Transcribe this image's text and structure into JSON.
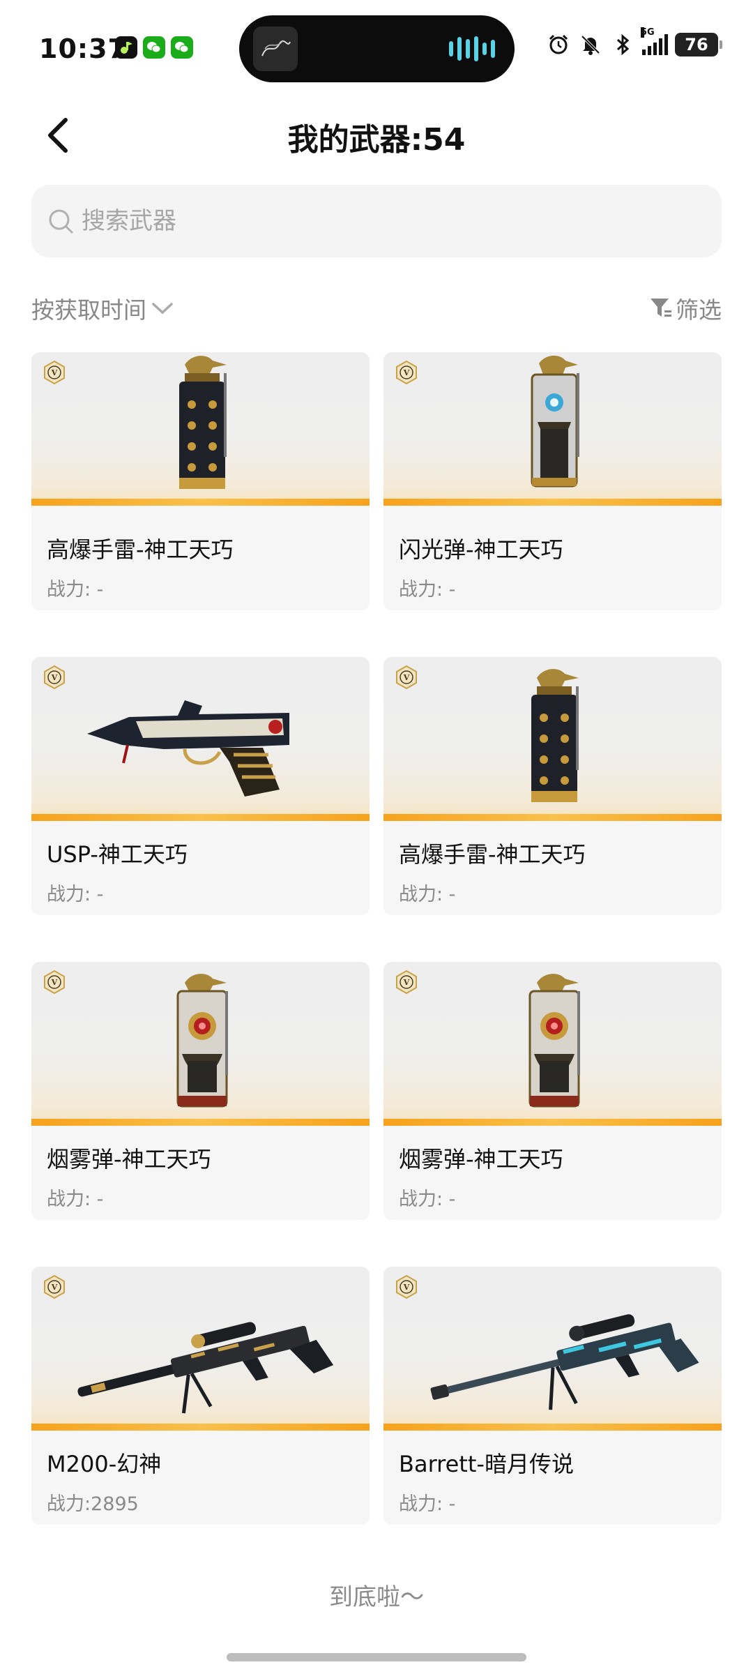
{
  "status_bar": {
    "time": "10:37",
    "app_icons": [
      "music-app-icon",
      "wechat-icon",
      "wechat-icon"
    ],
    "network": "5G",
    "battery": "76"
  },
  "nav": {
    "title": "我的武器:54"
  },
  "search": {
    "placeholder": "搜索武器",
    "value": ""
  },
  "toolbar": {
    "sort_label": "按获取时间",
    "filter_label": "筛选"
  },
  "weapons": [
    {
      "name": "高爆手雷-神工天巧",
      "power": "战力: -",
      "kind": "grenade"
    },
    {
      "name": "闪光弹-神工天巧",
      "power": "战力: -",
      "kind": "flashbang"
    },
    {
      "name": "USP-神工天巧",
      "power": "战力: -",
      "kind": "pistol"
    },
    {
      "name": "高爆手雷-神工天巧",
      "power": "战力: -",
      "kind": "grenade"
    },
    {
      "name": "烟雾弹-神工天巧",
      "power": "战力: -",
      "kind": "smoke"
    },
    {
      "name": "烟雾弹-神工天巧",
      "power": "战力: -",
      "kind": "smoke"
    },
    {
      "name": "M200-幻神",
      "power": "战力:2895",
      "kind": "sniper-gold"
    },
    {
      "name": "Barrett-暗月传说",
      "power": "战力: -",
      "kind": "sniper-blue"
    }
  ],
  "footer": {
    "end_text": "到底啦～"
  },
  "colors": {
    "accent_stripe": "#f7a21c",
    "card_bg": "#f6f6f6"
  }
}
